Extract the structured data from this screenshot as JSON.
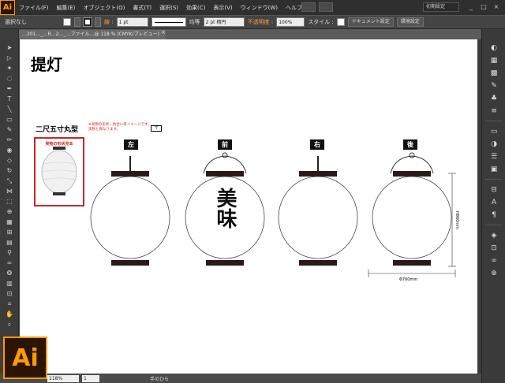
{
  "app": {
    "logo": "Ai"
  },
  "menu": {
    "items": [
      "ファイル(F)",
      "編集(E)",
      "オブジェクト(O)",
      "書式(T)",
      "選択(S)",
      "効果(C)",
      "表示(V)",
      "ウィンドウ(W)",
      "ヘルプ(H)"
    ],
    "workspace": "初期設定",
    "window_controls": [
      "_",
      "□",
      "×"
    ]
  },
  "control": {
    "selection": "選択なし",
    "stroke_label": "線 :",
    "stroke_width": "1 pt",
    "profile": "均等",
    "brush": "2 pt 楕円",
    "opacity_label": "不透明度 :",
    "opacity_value": "100%",
    "style_label": "スタイル :",
    "doc_setup": "ドキュメント設定",
    "prefs": "環境設定"
  },
  "tab": {
    "title": "…201…_…R…2…_…ファイル…@ 118 % (CMYK/プレビュー)",
    "close": "×"
  },
  "status": {
    "zoom": "118%",
    "page": "1",
    "tool": "手のひら"
  },
  "artwork": {
    "title": "提灯",
    "subtitle": "二尺五寸丸型",
    "note_lines": [
      "※実物の形状・色合い等イメージです。",
      "実物と異なります。"
    ],
    "note_box": "寸",
    "photo_caption": "実物の形状見本",
    "views": [
      "左",
      "前",
      "右",
      "後"
    ],
    "height_dim": "H860mm",
    "width_dim": "Φ760mm",
    "calligraphy": "美味"
  },
  "colors": {
    "accent": "#ff9a00",
    "canvas": "#ffffff",
    "chrome": "#3c3c3c",
    "red": "#c62828"
  }
}
